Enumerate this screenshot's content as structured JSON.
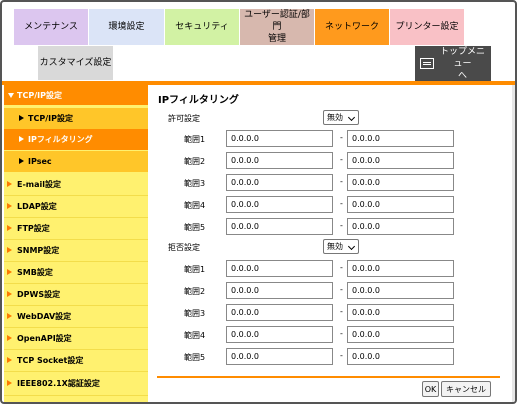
{
  "tabs": {
    "maintenance": "メンテナンス",
    "environment": "環境設定",
    "security": "セキュリティ",
    "auth_line1": "ユーザー認証/部門",
    "auth_line2": "管理",
    "network": "ネットワーク",
    "printer": "プリンター設定",
    "customize": "カスタマイズ設定"
  },
  "top_menu": {
    "line1": "トップメニュー",
    "line2": "へ",
    "icon": "top-menu-icon"
  },
  "sidebar": {
    "tcpip_group": "TCP/IP設定",
    "tcpip": "TCP/IP設定",
    "ipfilter": "IPフィルタリング",
    "ipsec": "IPsec",
    "items": [
      "E-mail設定",
      "LDAP設定",
      "FTP設定",
      "SNMP設定",
      "SMB設定",
      "DPWS設定",
      "WebDAV設定",
      "OpenAPI設定",
      "TCP Socket設定",
      "IEEE802.1X認証設定"
    ]
  },
  "main": {
    "title": "IPフィルタリング",
    "allow": {
      "label": "許可設定",
      "select_value": "無効",
      "ranges": [
        {
          "label": "範囲1",
          "from": "0.0.0.0",
          "to": "0.0.0.0"
        },
        {
          "label": "範囲2",
          "from": "0.0.0.0",
          "to": "0.0.0.0"
        },
        {
          "label": "範囲3",
          "from": "0.0.0.0",
          "to": "0.0.0.0"
        },
        {
          "label": "範囲4",
          "from": "0.0.0.0",
          "to": "0.0.0.0"
        },
        {
          "label": "範囲5",
          "from": "0.0.0.0",
          "to": "0.0.0.0"
        }
      ]
    },
    "deny": {
      "label": "拒否設定",
      "select_value": "無効",
      "ranges": [
        {
          "label": "範囲1",
          "from": "0.0.0.0",
          "to": "0.0.0.0"
        },
        {
          "label": "範囲2",
          "from": "0.0.0.0",
          "to": "0.0.0.0"
        },
        {
          "label": "範囲3",
          "from": "0.0.0.0",
          "to": "0.0.0.0"
        },
        {
          "label": "範囲4",
          "from": "0.0.0.0",
          "to": "0.0.0.0"
        },
        {
          "label": "範囲5",
          "from": "0.0.0.0",
          "to": "0.0.0.0"
        }
      ]
    },
    "range_separator": "-",
    "ok": "OK",
    "cancel": "キャンセル"
  }
}
